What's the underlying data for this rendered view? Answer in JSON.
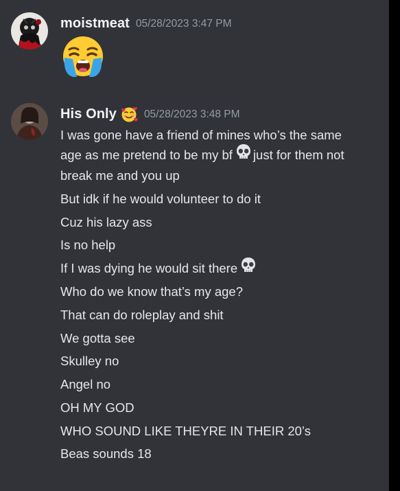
{
  "messages": [
    {
      "author": "moistmeat",
      "timestamp": "05/28/2023 3:47 PM",
      "emoji": "loudly-crying-face"
    },
    {
      "author": "His Only",
      "author_emoji": "smiling-face-with-hearts",
      "timestamp": "05/28/2023 3:48 PM",
      "lines": {
        "l1": "I was gone have a friend of mines who’s the same",
        "l2a": "age as me pretend to be my bf",
        "l2b": "just for them not",
        "l3": "break me and you up",
        "l4": "But idk if he would volunteer to do it",
        "l5": "Cuz his lazy ass",
        "l6": "Is no help",
        "l7": "If I was dying he would sit there",
        "l8": "Who do we know that’s my age?",
        "l9": "That can do roleplay and shit",
        "l10": "We gotta see",
        "l11": "Skulley no",
        "l12": "Angel no",
        "l13": "OH MY GOD",
        "l14": "WHO SOUND LIKE THEYRE IN THEIR 20’s",
        "l15": "Beas sounds 18"
      }
    }
  ],
  "colors": {
    "background": "#313338",
    "username": "#f2f3f5",
    "timestamp": "#949ba4",
    "text": "#e6e7ea"
  }
}
